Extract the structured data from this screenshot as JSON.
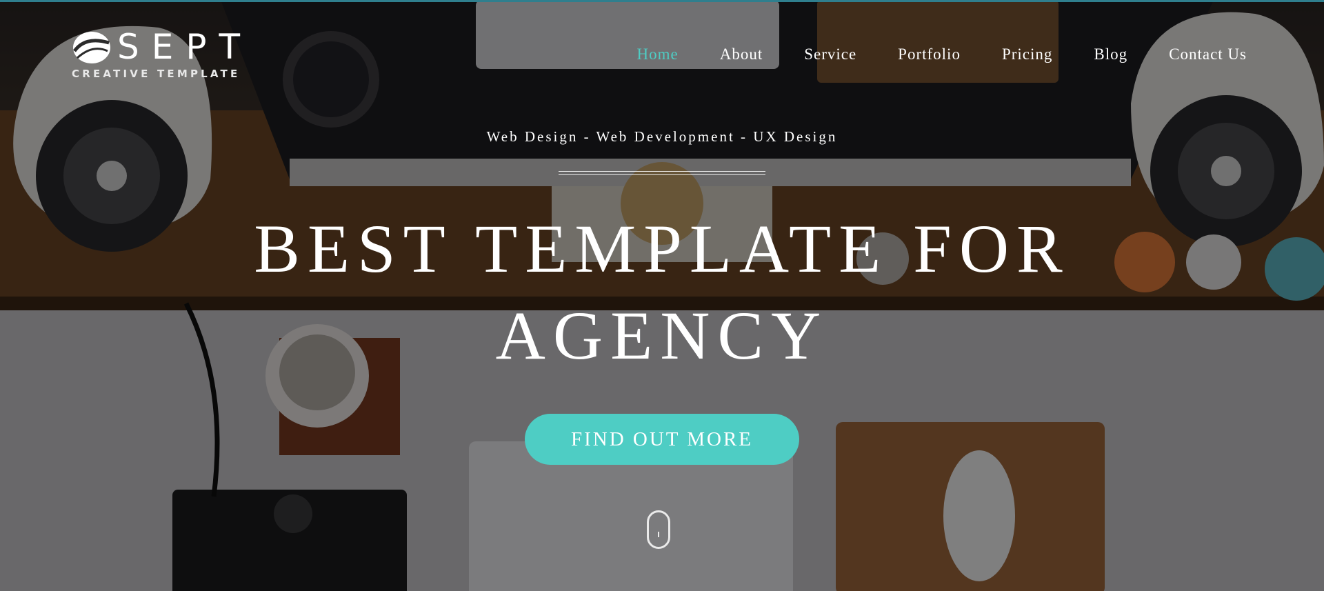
{
  "brand": {
    "name": "SEPT",
    "tagline": "CREATIVE TEMPLATE"
  },
  "nav": {
    "items": [
      {
        "label": "Home",
        "active": true
      },
      {
        "label": "About",
        "active": false
      },
      {
        "label": "Service",
        "active": false
      },
      {
        "label": "Portfolio",
        "active": false
      },
      {
        "label": "Pricing",
        "active": false
      },
      {
        "label": "Blog",
        "active": false
      },
      {
        "label": "Contact Us",
        "active": false
      }
    ]
  },
  "hero": {
    "subtitle": "Web Design - Web Development - UX Design",
    "headline_line1": "BEST TEMPLATE FOR",
    "headline_line2": "AGENCY",
    "cta_label": "FIND OUT MORE",
    "scroll_icon": "mouse-scroll-icon"
  },
  "colors": {
    "accent": "#4ecdc4",
    "text": "#ffffff",
    "top_bar": "#2f7f8e"
  }
}
